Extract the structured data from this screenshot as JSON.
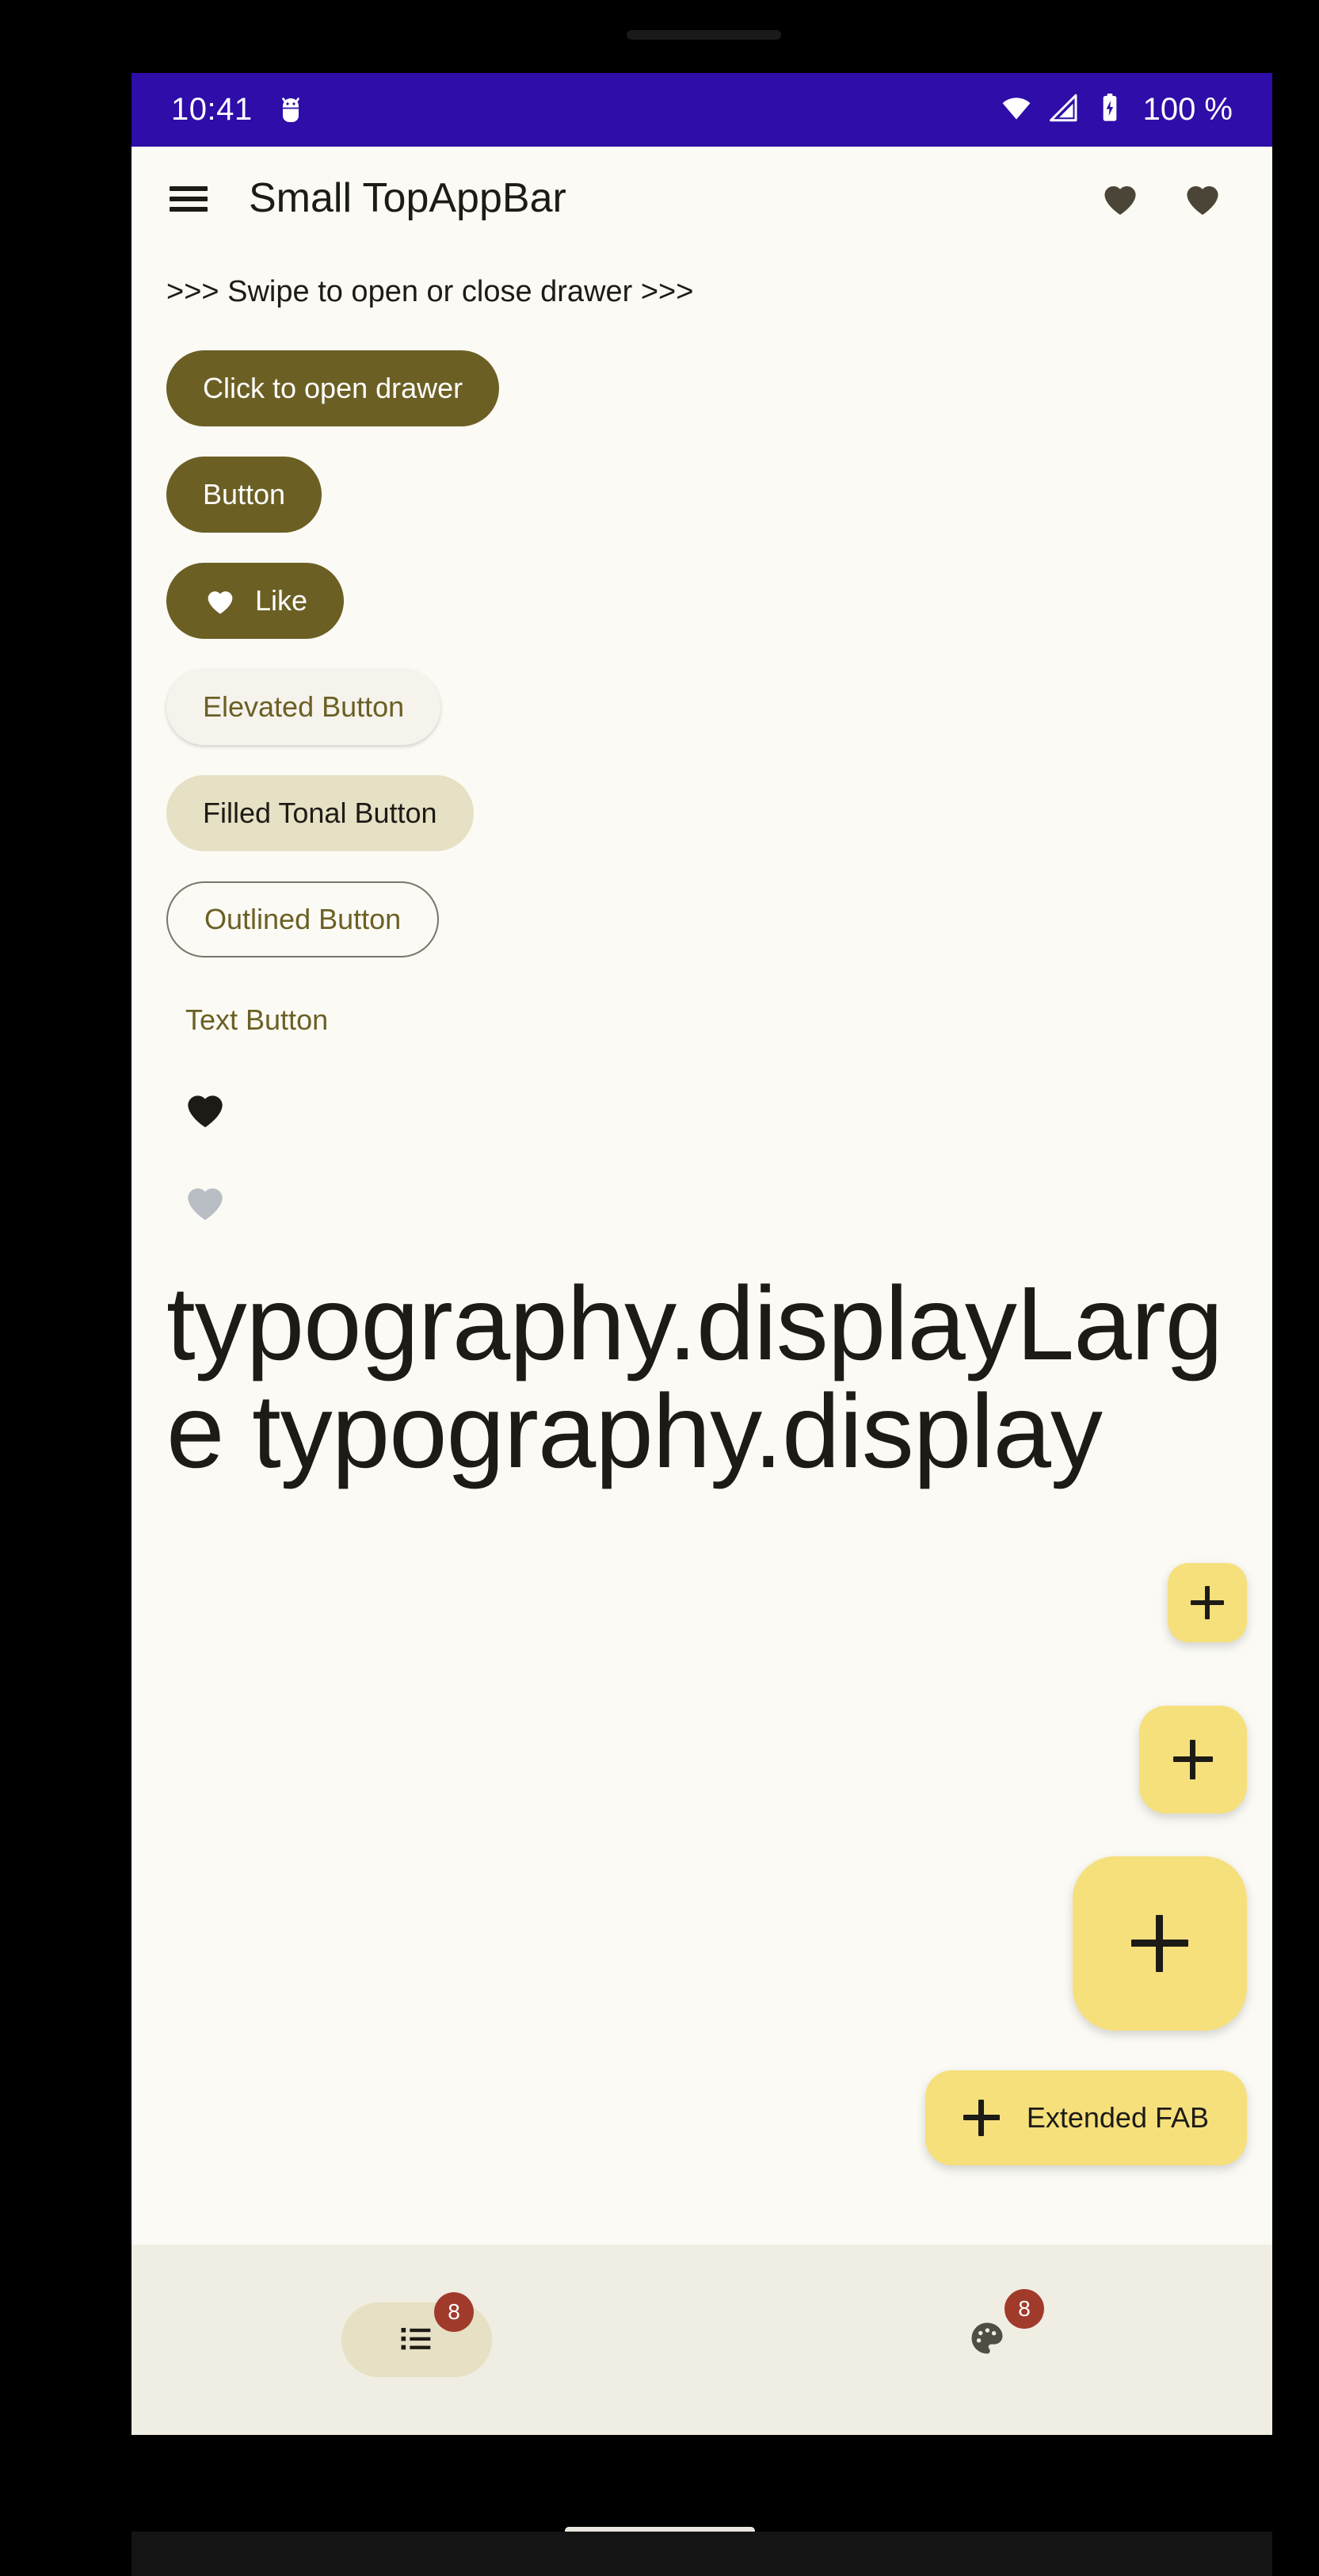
{
  "status_bar": {
    "time": "10:41",
    "battery_percent": "100 %",
    "bg_color": "#2E0DA8",
    "icons": [
      "android-bug-icon",
      "wifi-icon",
      "cell-signal-icon",
      "battery-charging-icon"
    ]
  },
  "app_bar": {
    "title": "Small TopAppBar",
    "menu_icon": "hamburger-menu-icon",
    "actions": [
      "heart-icon",
      "heart-icon"
    ],
    "icon_color": "#4A4536"
  },
  "content": {
    "swipe_hint": ">>> Swipe to open or close drawer >>>",
    "buttons": [
      {
        "name": "open-drawer-button",
        "label": "Click to open drawer",
        "style": "filled"
      },
      {
        "name": "plain-button",
        "label": "Button",
        "style": "filled"
      },
      {
        "name": "like-button",
        "label": "Like",
        "style": "filled",
        "icon": "heart-icon"
      },
      {
        "name": "elevated-button",
        "label": "Elevated Button",
        "style": "elevated"
      },
      {
        "name": "filled-tonal-button",
        "label": "Filled Tonal Button",
        "style": "tonal"
      },
      {
        "name": "outlined-button",
        "label": "Outlined Button",
        "style": "outlined"
      },
      {
        "name": "text-button",
        "label": "Text Button",
        "style": "text"
      }
    ],
    "icon_toggles": [
      {
        "name": "favorite-toggle-on",
        "icon": "heart-icon",
        "color": "#1D1B16",
        "state": "checked"
      },
      {
        "name": "favorite-toggle-off",
        "icon": "heart-icon",
        "color": "#B9BEC4",
        "state": "unchecked"
      }
    ],
    "typography_text": "typography.displayLarge typography.display"
  },
  "fabs": {
    "color": "#F6E07C",
    "small": {
      "name": "fab-small",
      "icon": "plus-icon"
    },
    "medium": {
      "name": "fab-medium",
      "icon": "plus-icon"
    },
    "large": {
      "name": "fab-large",
      "icon": "plus-icon"
    },
    "extended": {
      "name": "fab-extended",
      "icon": "plus-icon",
      "label": "Extended FAB"
    }
  },
  "bottom_nav": {
    "bg_color": "#F0EDE2",
    "badge_color": "#A03A2B",
    "items": [
      {
        "name": "nav-item-list",
        "icon": "list-icon",
        "badge": "8",
        "selected": true
      },
      {
        "name": "nav-item-palette",
        "icon": "palette-icon",
        "badge": "8",
        "selected": false
      }
    ]
  }
}
